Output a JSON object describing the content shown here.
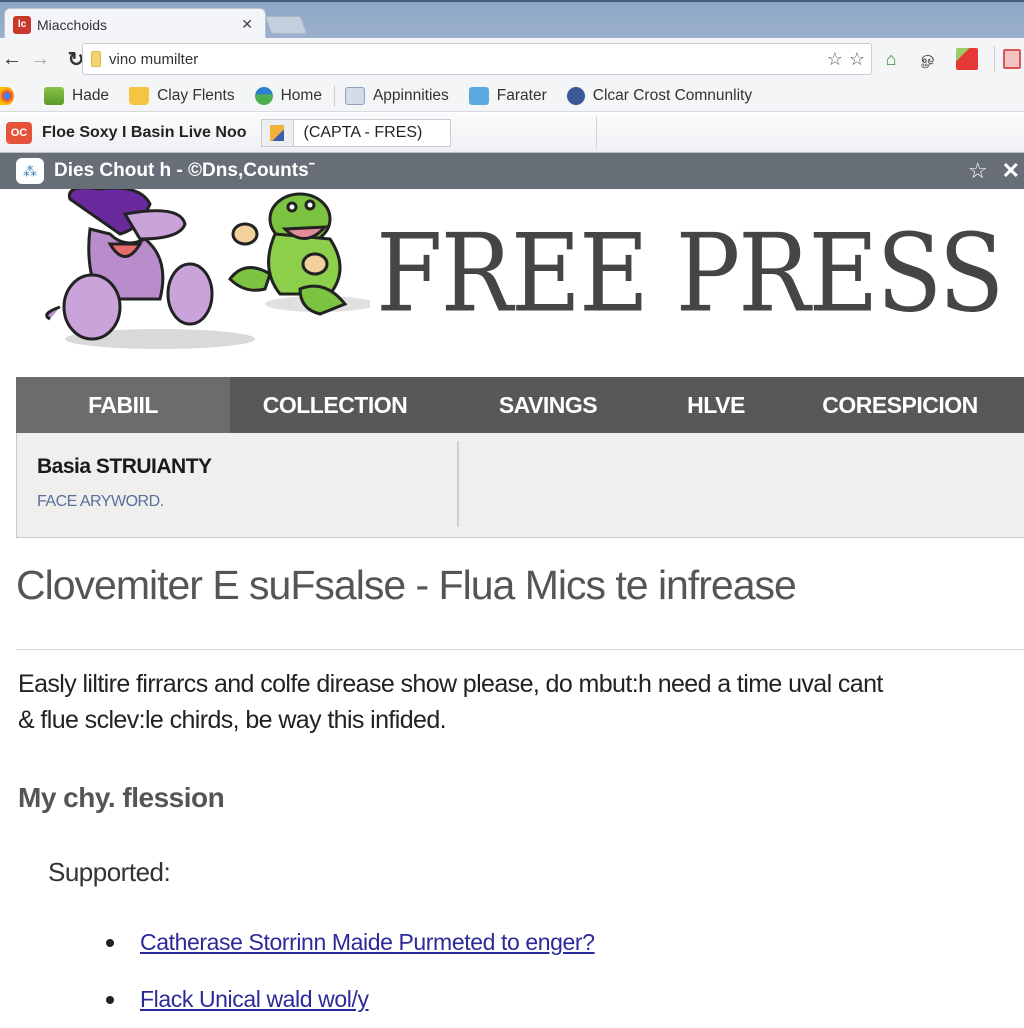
{
  "browser": {
    "tab": {
      "title": "Miacchoids",
      "favicon_text": "lc"
    },
    "address_bar": {
      "value": "vino mumilter",
      "placeholder": ""
    },
    "bookmarks": [
      {
        "label": "Hade",
        "icon": "green-folder-icon"
      },
      {
        "label": "Clay Flents",
        "icon": "shopping-bag-icon"
      },
      {
        "label": "Home",
        "icon": "drop-icon"
      },
      {
        "label": "Appinnities",
        "icon": "flag-icon"
      },
      {
        "label": "Farater",
        "icon": "calendar-icon"
      },
      {
        "label": "Clcar Crost Comnunlity",
        "icon": "globe-icon"
      }
    ],
    "subtabs": [
      {
        "label": "Floe Soxy I Basin Live Noo",
        "icon_text": "OC"
      },
      {
        "label": "(CAPTA - FRES)"
      }
    ],
    "page_bar": {
      "title": "Dies Chout h - ©Dns,Countsˉ",
      "star": "☆",
      "close": "✕"
    }
  },
  "site": {
    "logo": "FREE PRESS",
    "nav": [
      {
        "label": "FABIIL",
        "active": true
      },
      {
        "label": "COLLECTION",
        "active": false
      },
      {
        "label": "SAVINGS",
        "active": false
      },
      {
        "label": "HLVE",
        "active": false
      },
      {
        "label": "CORESPICION",
        "active": false
      }
    ],
    "subpanel": {
      "heading": "Basia STRUIANTY",
      "link": "FACE ARYWORD."
    }
  },
  "article": {
    "title": "Clovemiter E suFsalse - Flua Mics te infrease",
    "body_lines": [
      "Easly liltire firrarcs and colfe direase show please, do mbut:h need a time uval cant",
      "& flue sclev:le chirds, be way this infided."
    ],
    "section_title": "My chy. flession",
    "supported_label": "Supported:",
    "links": [
      "Catherase Storrinn Maide Purmeted to enger?",
      "Flack Unical wald wol/y"
    ]
  },
  "colors": {
    "nav_bg": "#585858",
    "nav_active_bg": "#6c6c6c",
    "page_bar_bg": "#686e78",
    "link": "#2a2a9a",
    "logo": "#454545"
  }
}
